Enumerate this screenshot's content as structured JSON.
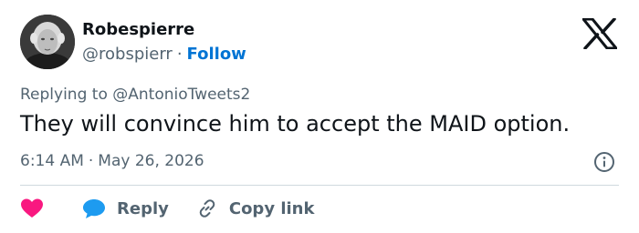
{
  "author": {
    "name": "Robespierre",
    "handle": "@robspierr",
    "separator": "·",
    "follow_label": "Follow"
  },
  "tweet": {
    "reply_prefix": "Replying to",
    "reply_mention": "@AntonioTweets2",
    "text": "They will convince him to accept the MAID option.",
    "time": "6:14 AM",
    "separator": "·",
    "date": "May 26, 2026"
  },
  "actions": {
    "reply_label": "Reply",
    "copy_link_label": "Copy link"
  },
  "colors": {
    "accent": "#0074d4",
    "heart": "#f91880",
    "reply_bubble": "#1d9bf0",
    "muted_text": "#536471"
  },
  "icons": {
    "brand": "x-logo-icon",
    "like": "heart-icon",
    "reply": "reply-bubble-icon",
    "copy": "link-icon",
    "info": "info-icon"
  }
}
